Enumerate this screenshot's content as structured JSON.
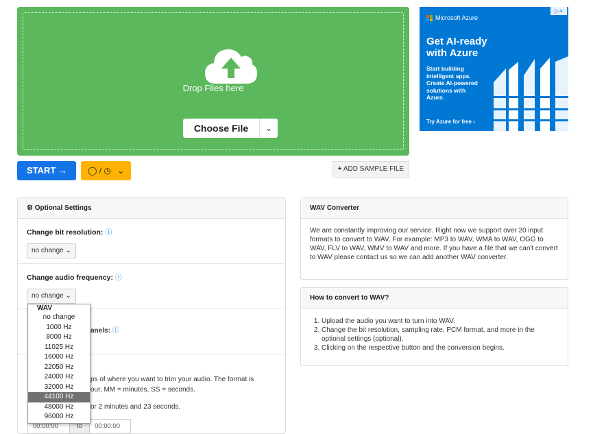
{
  "upload": {
    "drop_label": "Drop Files here",
    "choose_label": "Choose File",
    "start_label": "START",
    "sample_label": "ADD SAMPLE FILE"
  },
  "ad": {
    "brand": "Microsoft Azure",
    "headline_1": "Get AI-ready",
    "headline_2": "with Azure",
    "body_1": "Start building",
    "body_2": "intelligent apps.",
    "body_3": "Create AI-powered",
    "body_4": "solutions with",
    "body_5": "Azure.",
    "cta": "Try Azure for free ›",
    "colors": {
      "bg": "#0078d4"
    }
  },
  "options": {
    "title": "Optional Settings",
    "bit_label": "Change bit resolution:",
    "bit_value": "no change",
    "freq_label": "Change audio frequency:",
    "freq_value": "no change",
    "channels_tail": "anels:",
    "trim_line1": "ps of where you want to trim your audio. The format is",
    "trim_line2": "our, MM = minutes, SS = seconds.",
    "trim_line3": "or 2 minutes and 23 seconds.",
    "time_from": "00:00:00",
    "time_to_label": "to",
    "time_to": "00:00:00"
  },
  "dropdown": {
    "group": "WAV",
    "options": [
      "no change",
      "1000 Hz",
      "8000 Hz",
      "11025 Hz",
      "16000 Hz",
      "22050 Hz",
      "24000 Hz",
      "32000 Hz",
      "44100 Hz",
      "48000 Hz",
      "96000 Hz"
    ],
    "highlighted": "44100 Hz"
  },
  "converter": {
    "title": "WAV Converter",
    "text": "We are constantly improving our service. Right now we support over 20 input formats to convert to WAV. For example: MP3 to WAV, WMA to WAV, OGG to WAV, FLV to WAV, WMV to WAV and more. If you have a file that we can't convert to WAV please contact us so we can add another WAV converter."
  },
  "howto": {
    "title": "How to convert to WAV?",
    "steps": [
      "Upload the audio you want to turn into WAV.",
      "Change the bit resolution, sampling rate, PCM format, and more in the optional settings (optional).",
      "Clicking on the respective button and the conversion begins."
    ]
  },
  "colors": {
    "green": "#5cb85c",
    "blue": "#1473e6",
    "amber": "#ffb300"
  }
}
